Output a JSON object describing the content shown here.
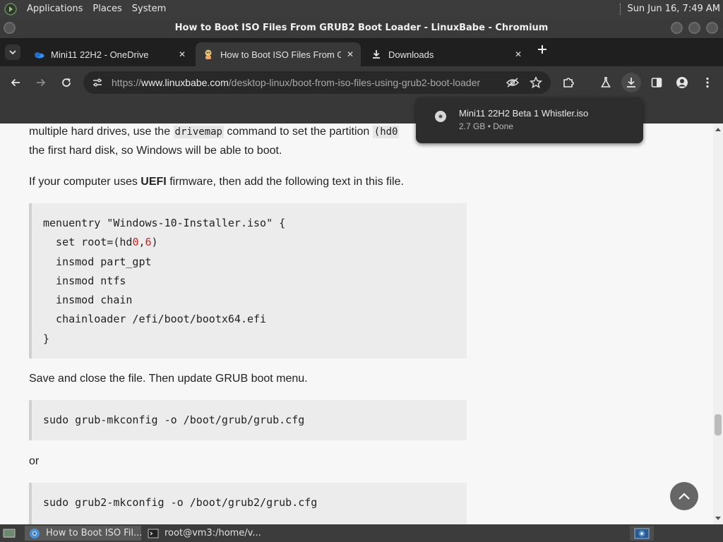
{
  "top_panel": {
    "menu": [
      "Applications",
      "Places",
      "System"
    ],
    "clock": "Sun Jun 16,  7:49 AM"
  },
  "window": {
    "title": "How to Boot ISO Files From GRUB2 Boot Loader - LinuxBabe - Chromium"
  },
  "tabs": [
    {
      "label": "Mini11 22H2 - OneDrive",
      "icon": "onedrive-icon"
    },
    {
      "label": "How to Boot ISO Files From G",
      "icon": "linuxbabe-icon",
      "active": true
    },
    {
      "label": "Downloads",
      "icon": "download-icon"
    }
  ],
  "omnibox": {
    "scheme": "https://",
    "host": "www.linuxbabe.com",
    "path": "/desktop-linux/boot-from-iso-files-using-grub2-boot-loader"
  },
  "download_bubble": {
    "filename": "Mini11 22H2 Beta 1 Whistler.iso",
    "status": "2.7 GB • Done"
  },
  "article": {
    "p1_a": "multiple hard drives, use the ",
    "p1_code": "drivemap",
    "p1_b": " command to set the partition ",
    "p1_code2": "(hd0",
    "p1_line2": "the first hard disk, so Windows will be able to boot.",
    "p2_a": "If your computer uses ",
    "p2_bold": "UEFI",
    "p2_b": " firmware, then add the following text in this file.",
    "code1": {
      "l1": "menuentry \"Windows-10-Installer.iso\" {",
      "l2a": "  set root=(hd",
      "l2n1": "0",
      "l2c": ",",
      "l2n2": "6",
      "l2d": ")",
      "l3": "  insmod part_gpt",
      "l4": "  insmod ntfs",
      "l5": "  insmod chain",
      "l6": "  chainloader /efi/boot/bootx64.efi",
      "l7": "}"
    },
    "p3": "Save and close the file. Then update GRUB boot menu.",
    "code2": "sudo grub-mkconfig -o /boot/grub/grub.cfg",
    "p4": "or",
    "code3": "sudo grub2-mkconfig -o /boot/grub2/grub.cfg"
  },
  "taskbar": {
    "items": [
      "How to Boot ISO Fil...",
      "root@vm3:/home/v..."
    ]
  },
  "colors": {
    "page_bg": "#f7f7f7",
    "code_bg": "#ececec",
    "toolbar_bg": "#383838",
    "number_red": "#c22222"
  }
}
